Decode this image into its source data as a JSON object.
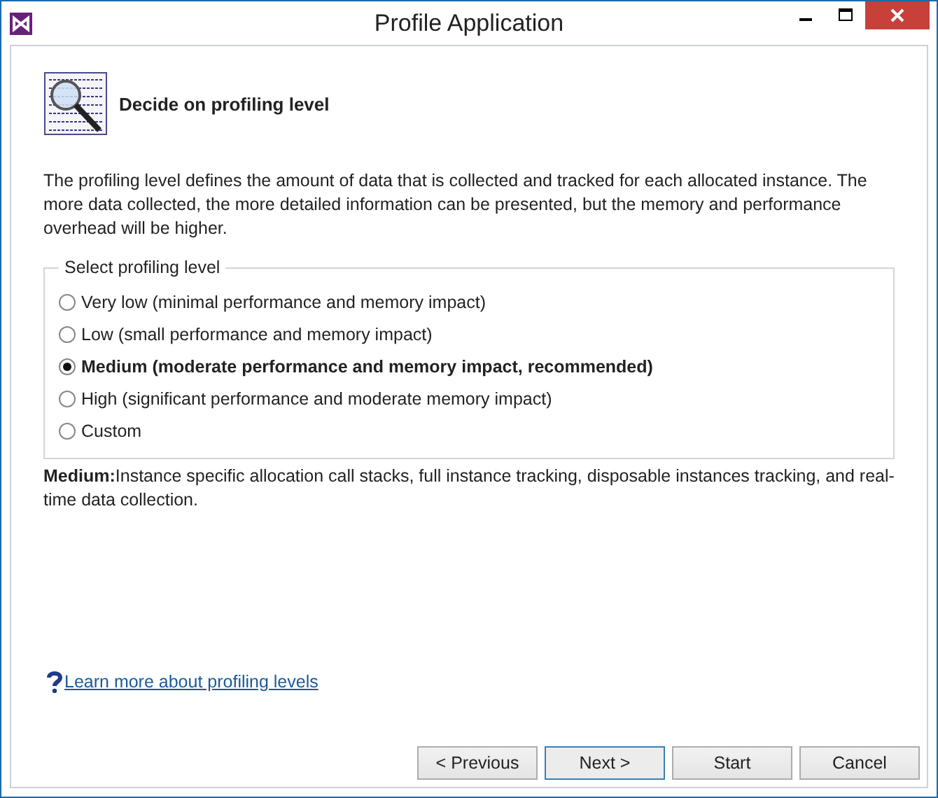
{
  "window": {
    "title": "Profile Application"
  },
  "header": {
    "title": "Decide on profiling level"
  },
  "description": "The profiling level defines the amount of data that is collected and tracked for each allocated instance. The more data collected, the more detailed information can be presented, but the memory and performance overhead will be higher.",
  "level_group": {
    "title": "Select profiling level",
    "options": [
      {
        "label": "Very low (minimal performance and memory impact)",
        "selected": false
      },
      {
        "label": "Low (small performance and memory impact)",
        "selected": false
      },
      {
        "label": "Medium (moderate performance and memory impact, recommended)",
        "selected": true
      },
      {
        "label": "High (significant performance and moderate memory impact)",
        "selected": false
      },
      {
        "label": "Custom",
        "selected": false
      }
    ]
  },
  "level_note": "**Medium:**Instance specific allocation call stacks, full instance tracking, disposable instances tracking, and real-time data collection.",
  "help_link": "Learn more about profiling levels",
  "buttons": [
    {
      "label": "< Previous",
      "default": false
    },
    {
      "label": "Next >",
      "default": true
    },
    {
      "label": "Start",
      "default": false
    },
    {
      "label": "Cancel",
      "default": false
    }
  ]
}
